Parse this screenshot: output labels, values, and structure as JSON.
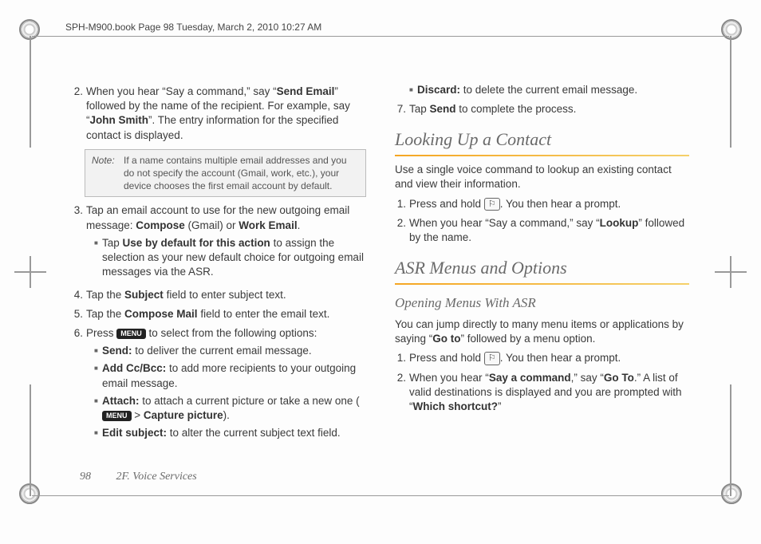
{
  "header_run": "SPH-M900.book  Page 98  Tuesday, March 2, 2010  10:27 AM",
  "footer": {
    "page": "98",
    "section": "2F. Voice Services"
  },
  "left": {
    "step2": {
      "num": "2.",
      "pre": "When you hear “Say a command,” say “",
      "b1": "Send Email",
      "mid": "” followed by the name of the recipient. For example, say “",
      "b2": "John Smith",
      "post": "”. The entry information for the specified contact is displayed."
    },
    "note": {
      "label": "Note:",
      "text": "If a name contains multiple email addresses and you do not specify the account (Gmail, work, etc.), your device chooses the first email account by default."
    },
    "step3": {
      "num": "3.",
      "pre": "Tap an email account to use for the new outgoing email message: ",
      "b1": "Compose",
      "mid1": " (Gmail) or ",
      "b2": "Work Email",
      "post": "."
    },
    "step3_sub": {
      "pre": "Tap ",
      "b": "Use by default for this action",
      "post": " to assign the selection as your new default choice for outgoing email messages via the ASR."
    },
    "step4": {
      "num": "4.",
      "pre": "Tap the ",
      "b": "Subject",
      "post": " field to enter subject text."
    },
    "step5": {
      "num": "5.",
      "pre": "Tap the ",
      "b": "Compose Mail",
      "post": " field to enter the email text."
    },
    "step6": {
      "num": "6.",
      "pre": "Press ",
      "menu": "MENU",
      "post": " to select from the following options:"
    },
    "s6b1": {
      "b": "Send:",
      "post": " to deliver the current email message."
    },
    "s6b2": {
      "b": "Add Cc/Bcc:",
      "post": " to add more recipients to your outgoing email message."
    },
    "s6b3": {
      "b": "Attach:",
      "mid": " to attach a current picture or take a new one (",
      "menu": "MENU",
      "gt": " > ",
      "b2": "Capture picture",
      "post": ")."
    },
    "s6b4": {
      "b": "Edit subject:",
      "post": " to alter the current subject text field."
    }
  },
  "right": {
    "s6b5": {
      "b": "Discard:",
      "post": " to delete the current email message."
    },
    "step7": {
      "num": "7.",
      "pre": "Tap ",
      "b": "Send",
      "post": " to complete the process."
    },
    "h_lookup": "Looking Up a Contact",
    "lookup_intro": "Use a single voice command to lookup an existing contact and view their information.",
    "l1": {
      "num": "1.",
      "pre": "Press and hold ",
      "key": "⚐",
      "post": ". You then hear a prompt."
    },
    "l2": {
      "num": "2.",
      "pre": "When you hear “Say a command,” say “",
      "b": "Lookup",
      "post": "” followed by the name."
    },
    "h_asr": "ASR Menus and Options",
    "h_open": "Opening Menus With ASR",
    "open_intro_pre": "You can jump directly to many menu items or applications by saying “",
    "open_intro_b": "Go to",
    "open_intro_post": "” followed by a menu option.",
    "o1": {
      "num": "1.",
      "pre": "Press and hold ",
      "key": "⚐",
      "post": ". You then hear a prompt."
    },
    "o2": {
      "num": "2.",
      "pre": "When you hear “",
      "b1": "Say a command",
      "mid1": ",” say “",
      "b2": "Go To",
      "mid2": ".” A list of valid destinations is displayed and you are prompted with “",
      "b3": "Which shortcut?",
      "post": "”"
    }
  }
}
